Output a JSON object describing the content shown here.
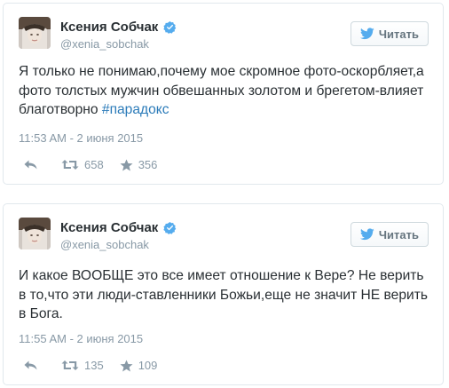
{
  "colors": {
    "text": "#292f33",
    "secondary": "#8899a6",
    "link": "#2b7bb9",
    "verified": "#55acee",
    "border": "#e1e8ed",
    "bird": "#55acee"
  },
  "tweets": [
    {
      "author_name": "Ксения Собчак",
      "handle": "@xenia_sobchak",
      "verified_icon": "verified-badge-icon",
      "follow_label": "Читать",
      "text": "Я только не понимаю,почему мое скромное фото-оскорбляет,а фото толстых мужчин обвешанных золотом и брегетом-влияет благотворно ",
      "hashtag": "#парадокс",
      "timestamp": "11:53 AM - 2 июня 2015",
      "retweets": "658",
      "likes": "356"
    },
    {
      "author_name": "Ксения Собчак",
      "handle": "@xenia_sobchak",
      "verified_icon": "verified-badge-icon",
      "follow_label": "Читать",
      "text": "И какое ВООБЩЕ это все имеет отношение к Вере? Не верить в то,что эти люди-ставленники Божьи,еще не значит НЕ верить в Бога.",
      "hashtag": "",
      "timestamp": "11:55 AM - 2 июня 2015",
      "retweets": "135",
      "likes": "109"
    }
  ]
}
